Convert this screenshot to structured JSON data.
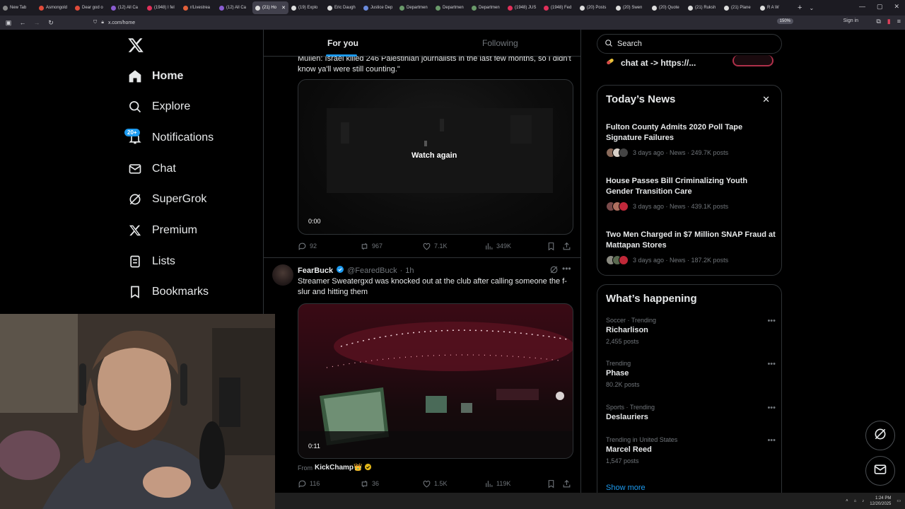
{
  "browser": {
    "tabs": [
      {
        "label": "New Tab",
        "active": false
      },
      {
        "label": "Asmongold",
        "active": false
      },
      {
        "label": "Dear god o",
        "active": false
      },
      {
        "label": "(12) All Ca",
        "active": false
      },
      {
        "label": "(1948) I fel",
        "active": false
      },
      {
        "label": "r/Livestrea",
        "active": false
      },
      {
        "label": "(12) All Ca",
        "active": false
      },
      {
        "label": "(21) Ho",
        "active": true
      },
      {
        "label": "(19) Explo",
        "active": false
      },
      {
        "label": "Eric Daugh",
        "active": false
      },
      {
        "label": "Justice Dep",
        "active": false
      },
      {
        "label": "Departmen",
        "active": false
      },
      {
        "label": "Departmen",
        "active": false
      },
      {
        "label": "Departmen",
        "active": false
      },
      {
        "label": "(1948) JUS",
        "active": false
      },
      {
        "label": "(1948) Fed",
        "active": false
      },
      {
        "label": "(20) Posts",
        "active": false
      },
      {
        "label": "(20) Swen",
        "active": false
      },
      {
        "label": "(20) Quote",
        "active": false
      },
      {
        "label": "(21) Ruksh",
        "active": false
      },
      {
        "label": "(21) Plane",
        "active": false
      },
      {
        "label": "R A W",
        "active": false
      }
    ],
    "url": "x.com/home",
    "zoom": "150%",
    "sign_in": "Sign in"
  },
  "sidebar": {
    "notif_badge": "20+",
    "items": [
      {
        "label": "Home",
        "icon": "home-icon"
      },
      {
        "label": "Explore",
        "icon": "search-icon"
      },
      {
        "label": "Notifications",
        "icon": "bell-icon"
      },
      {
        "label": "Chat",
        "icon": "mail-icon"
      },
      {
        "label": "SuperGrok",
        "icon": "grok-icon"
      },
      {
        "label": "Premium",
        "icon": "x-logo-icon"
      },
      {
        "label": "Lists",
        "icon": "list-icon"
      },
      {
        "label": "Bookmarks",
        "icon": "bookmark-icon"
      }
    ]
  },
  "feed": {
    "tabs": {
      "for_you": "For you",
      "following": "Following"
    },
    "post1": {
      "text": "Mullen: Israel killed 246 Palestinian journalists in the last few months, so I didn't know ya'll were still counting.\"",
      "video_overlay": "Watch again",
      "video_time": "0:00",
      "replies": "92",
      "reposts": "967",
      "likes": "7.1K",
      "views": "349K"
    },
    "post2": {
      "name": "FearBuck",
      "handle": "@FearedBuck",
      "time": "1h",
      "text": "Streamer Sweatergxd was knocked out at the club after calling someone the f-slur and hitting them",
      "video_time": "0:11",
      "from_prefix": "From",
      "from_source": "KickChamp👑",
      "replies": "116",
      "reposts": "36",
      "likes": "1.5K",
      "views": "119K"
    }
  },
  "right": {
    "search_placeholder": "Search",
    "chat_line": "chat at -> https://...",
    "news": {
      "title": "Today’s News",
      "items": [
        {
          "headline": "Fulton County Admits 2020 Poll Tape Signature Failures",
          "meta": "3 days ago · News · 249.7K posts"
        },
        {
          "headline": "House Passes Bill Criminalizing Youth Gender Transition Care",
          "meta": "3 days ago · News · 439.1K posts"
        },
        {
          "headline": "Two Men Charged in $7 Million SNAP Fraud at Mattapan Stores",
          "meta": "3 days ago · News · 187.2K posts"
        }
      ]
    },
    "happening": {
      "title": "What’s happening",
      "trends": [
        {
          "category": "Soccer · Trending",
          "name": "Richarlison",
          "count": "2,455 posts"
        },
        {
          "category": "Trending",
          "name": "Phase",
          "count": "80.2K posts"
        },
        {
          "category": "Sports · Trending",
          "name": "Deslauriers",
          "count": ""
        },
        {
          "category": "Trending in United States",
          "name": "Marcel Reed",
          "count": "1,547 posts"
        }
      ],
      "show_more": "Show more"
    }
  },
  "taskbar": {
    "time": "1:24 PM",
    "date": "12/20/2025"
  },
  "colors": {
    "accent": "#1d9bf0",
    "bg": "#000000",
    "border": "#2f3336",
    "muted": "#71767b"
  }
}
